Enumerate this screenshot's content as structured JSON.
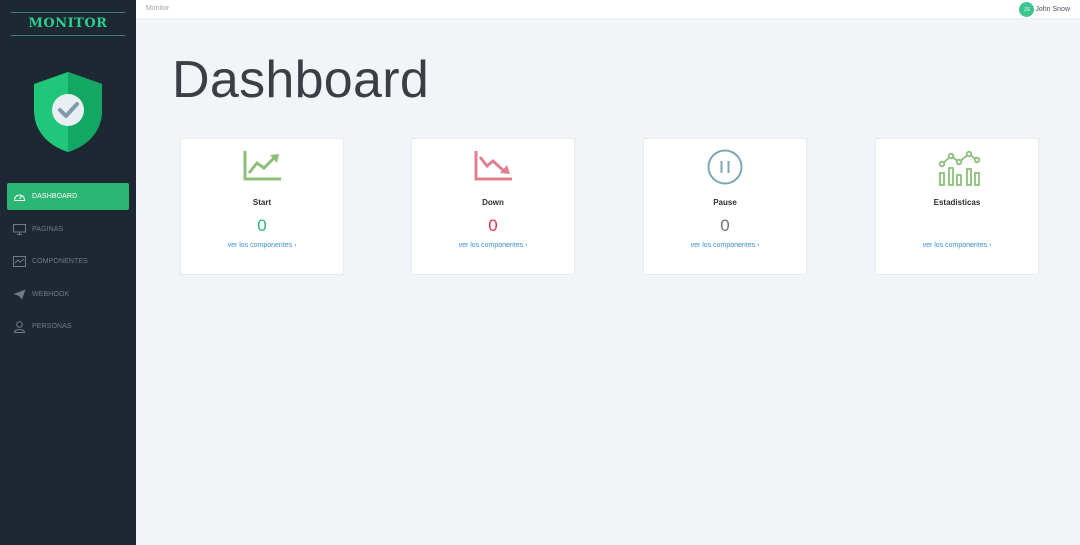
{
  "sidebar": {
    "brand": "MONITOR",
    "items": [
      {
        "label": "DASHBOARD",
        "icon": "gauge-icon",
        "active": true
      },
      {
        "label": "PAGINAS",
        "icon": "monitor-icon",
        "active": false
      },
      {
        "label": "COMPONENTES",
        "icon": "activity-chart-icon",
        "active": false
      },
      {
        "label": "WEBHOOK",
        "icon": "paper-plane-icon",
        "active": false
      },
      {
        "label": "PERSONAS",
        "icon": "person-icon",
        "active": false
      }
    ]
  },
  "topbar": {
    "breadcrumb": "Monitor",
    "user": {
      "initials": "JS",
      "name": "John Snow"
    }
  },
  "main": {
    "title": "Dashboard",
    "cards": [
      {
        "title": "Start",
        "value": "0",
        "link": "ver los componentes ›",
        "icon": "trend-up-icon",
        "color": "#2bb673"
      },
      {
        "title": "Down",
        "value": "0",
        "link": "ver los componentes ›",
        "icon": "trend-down-icon",
        "color": "#e0334c"
      },
      {
        "title": "Pause",
        "value": "0",
        "link": "ver los componentes ›",
        "icon": "pause-circle-icon",
        "color": "#6c757d"
      },
      {
        "title": "Estadisticas",
        "value": "",
        "link": "ver los componentes ›",
        "icon": "stats-chart-icon",
        "color": "#2bb673"
      }
    ]
  },
  "colors": {
    "sidebar_bg": "#1e2833",
    "accent": "#2bb673",
    "brand": "#2ad18d",
    "link": "#3a8fd8",
    "page_bg": "#f2f5f8"
  }
}
